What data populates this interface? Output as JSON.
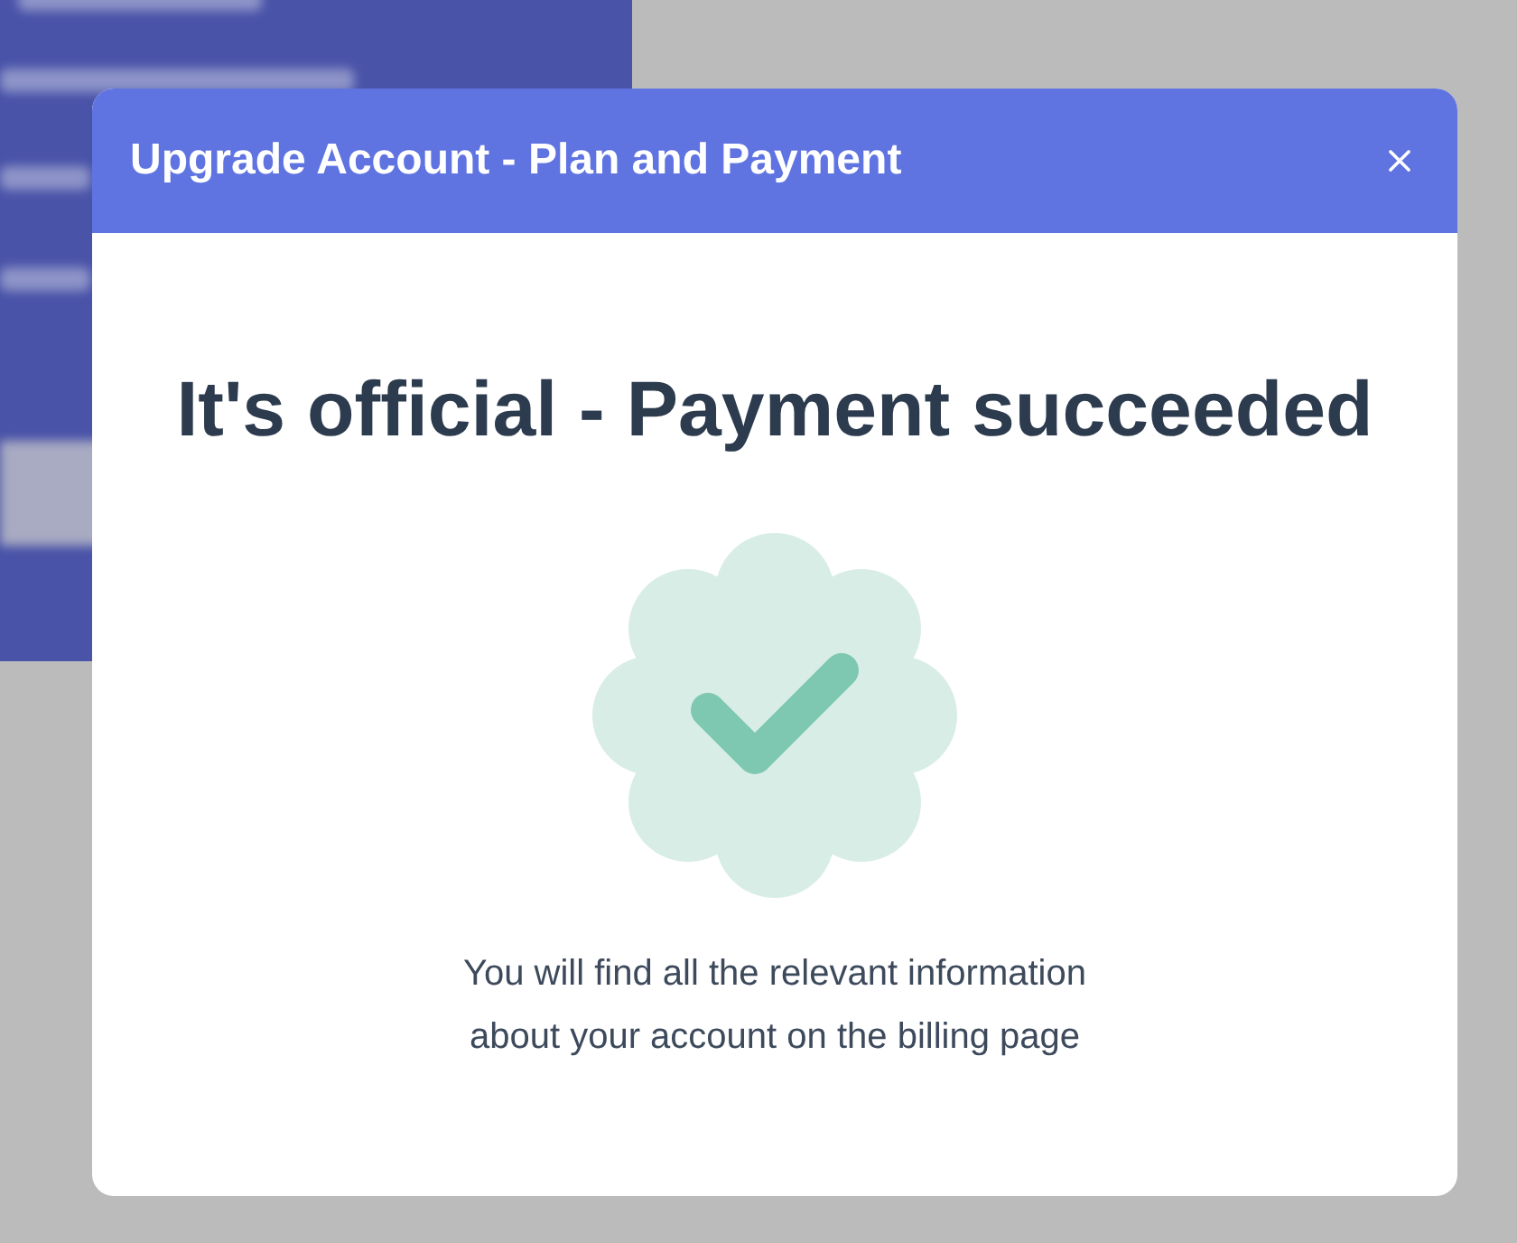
{
  "dialog": {
    "title": "Upgrade Account - Plan and Payment",
    "heading": "It's official - Payment succeeded",
    "message": "You will find all the relevant information about your account on the billing page"
  }
}
